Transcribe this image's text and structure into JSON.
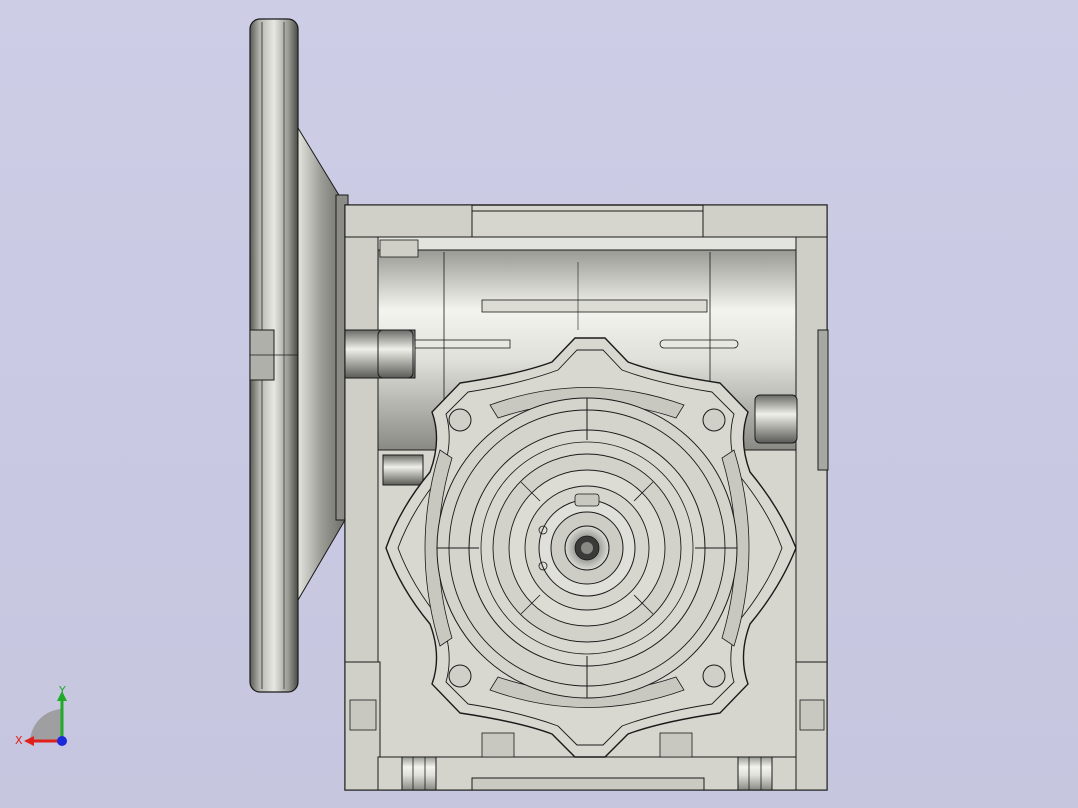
{
  "viewport": {
    "background": "#cacae4",
    "model": "worm-gear-reducer"
  },
  "triad": {
    "x_label": "X",
    "y_label": "Y",
    "x_color": "#e0201a",
    "y_color": "#1faa2a",
    "z_color": "#1a2ad8"
  },
  "colors": {
    "housing": "#d7d7d0",
    "housing_dark": "#b8b8b0",
    "edge": "#1a1a1a",
    "metal_light": "#efefea",
    "metal_dark": "#6a6a66"
  }
}
